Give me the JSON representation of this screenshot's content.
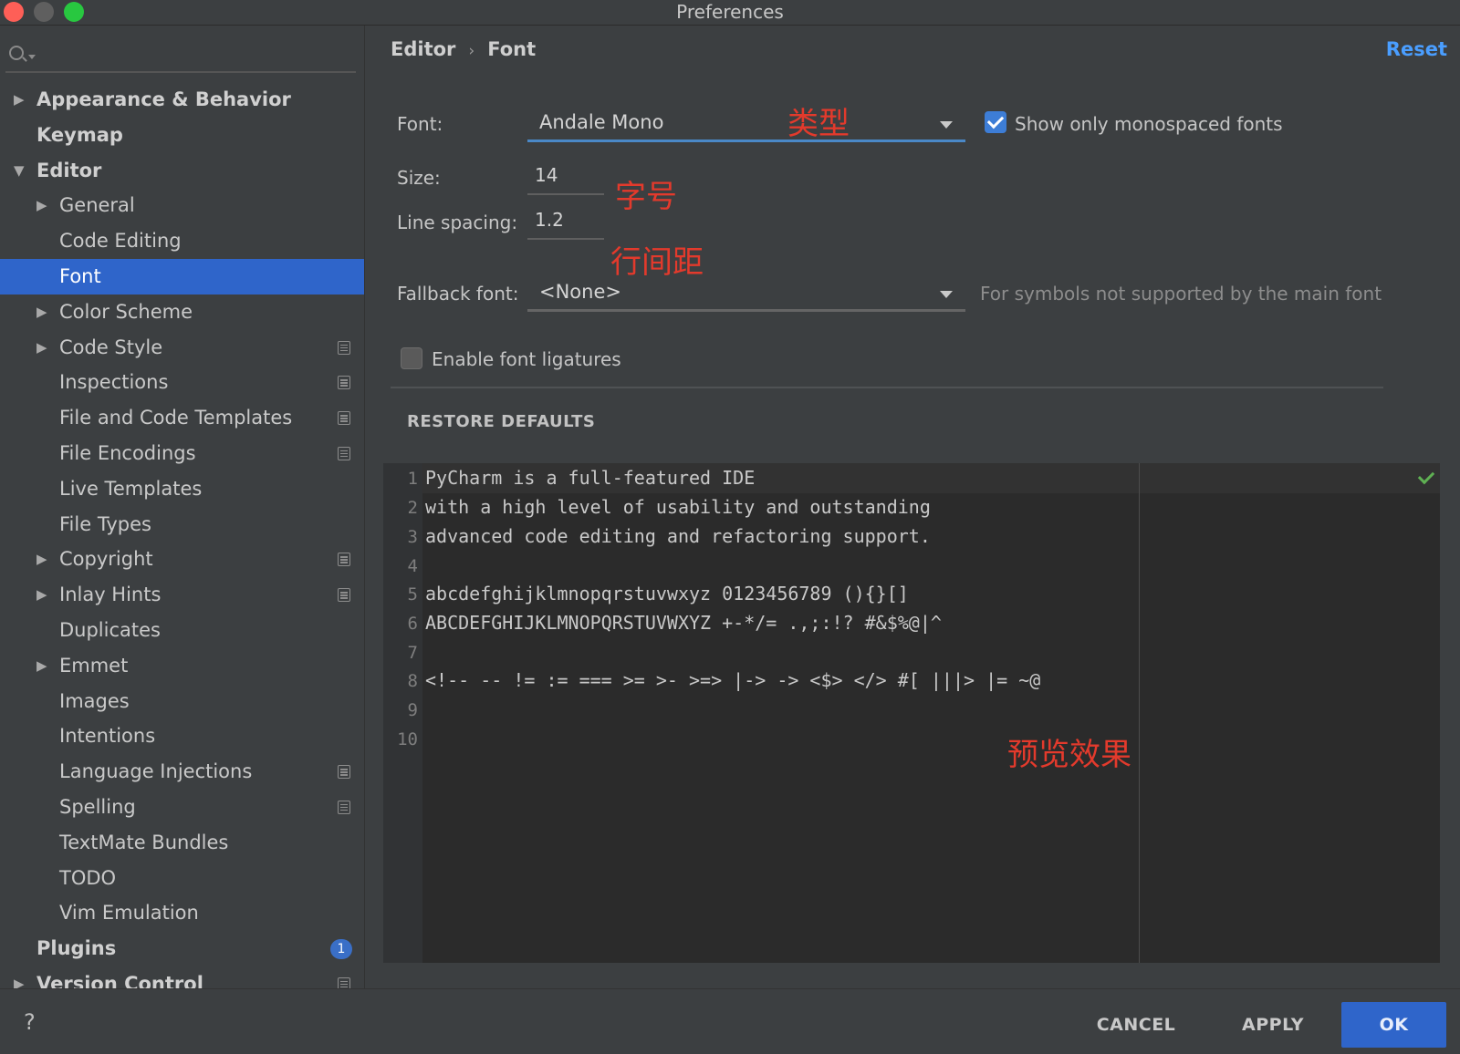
{
  "window": {
    "title": "Preferences"
  },
  "search": {
    "placeholder": "",
    "value": ""
  },
  "sidebar": {
    "items": [
      {
        "label": "Appearance & Behavior",
        "level": 0,
        "arrow": "right",
        "config": false
      },
      {
        "label": "Keymap",
        "level": 0,
        "arrow": "",
        "config": false
      },
      {
        "label": "Editor",
        "level": 0,
        "arrow": "down",
        "config": false
      },
      {
        "label": "General",
        "level": 1,
        "arrow": "right",
        "config": false
      },
      {
        "label": "Code Editing",
        "level": 1,
        "arrow": "",
        "config": false
      },
      {
        "label": "Font",
        "level": 1,
        "arrow": "",
        "config": false,
        "selected": true
      },
      {
        "label": "Color Scheme",
        "level": 1,
        "arrow": "right",
        "config": false
      },
      {
        "label": "Code Style",
        "level": 1,
        "arrow": "right",
        "config": true
      },
      {
        "label": "Inspections",
        "level": 1,
        "arrow": "",
        "config": true
      },
      {
        "label": "File and Code Templates",
        "level": 1,
        "arrow": "",
        "config": true
      },
      {
        "label": "File Encodings",
        "level": 1,
        "arrow": "",
        "config": true
      },
      {
        "label": "Live Templates",
        "level": 1,
        "arrow": "",
        "config": false
      },
      {
        "label": "File Types",
        "level": 1,
        "arrow": "",
        "config": false
      },
      {
        "label": "Copyright",
        "level": 1,
        "arrow": "right",
        "config": true
      },
      {
        "label": "Inlay Hints",
        "level": 1,
        "arrow": "right",
        "config": true
      },
      {
        "label": "Duplicates",
        "level": 1,
        "arrow": "",
        "config": false
      },
      {
        "label": "Emmet",
        "level": 1,
        "arrow": "right",
        "config": false
      },
      {
        "label": "Images",
        "level": 1,
        "arrow": "",
        "config": false
      },
      {
        "label": "Intentions",
        "level": 1,
        "arrow": "",
        "config": false
      },
      {
        "label": "Language Injections",
        "level": 1,
        "arrow": "",
        "config": true
      },
      {
        "label": "Spelling",
        "level": 1,
        "arrow": "",
        "config": true
      },
      {
        "label": "TextMate Bundles",
        "level": 1,
        "arrow": "",
        "config": false
      },
      {
        "label": "TODO",
        "level": 1,
        "arrow": "",
        "config": false
      },
      {
        "label": "Vim Emulation",
        "level": 1,
        "arrow": "",
        "config": false
      },
      {
        "label": "Plugins",
        "level": 0,
        "arrow": "",
        "config": false,
        "badge": "1"
      },
      {
        "label": "Version Control",
        "level": 0,
        "arrow": "right",
        "config": true
      }
    ]
  },
  "breadcrumb": {
    "parent": "Editor",
    "separator": "›",
    "current": "Font"
  },
  "reset_label": "Reset",
  "font_settings": {
    "font_label": "Font:",
    "font_value": "Andale Mono",
    "show_mono_label": "Show only monospaced fonts",
    "show_mono_checked": true,
    "size_label": "Size:",
    "size_value": "14",
    "line_spacing_label": "Line spacing:",
    "line_spacing_value": "1.2",
    "fallback_label": "Fallback font:",
    "fallback_value": "<None>",
    "fallback_hint": "For symbols not supported by the main font",
    "ligatures_label": "Enable font ligatures",
    "ligatures_checked": false,
    "restore_label": "RESTORE DEFAULTS"
  },
  "annotations": {
    "type": "类型",
    "size": "字号",
    "line_spacing": "行间距",
    "preview": "预览效果"
  },
  "preview": {
    "lines": [
      {
        "num": "1",
        "text": "PyCharm is a full-featured IDE"
      },
      {
        "num": "2",
        "text": "with a high level of usability and outstanding"
      },
      {
        "num": "3",
        "text": "advanced code editing and refactoring support."
      },
      {
        "num": "4",
        "text": ""
      },
      {
        "num": "5",
        "text": "abcdefghijklmnopqrstuvwxyz 0123456789 (){}[]"
      },
      {
        "num": "6",
        "text": "ABCDEFGHIJKLMNOPQRSTUVWXYZ +-*/= .,;:!? #&$%@|^"
      },
      {
        "num": "7",
        "text": ""
      },
      {
        "num": "8",
        "text": "<!-- -- != := === >= >- >=> |-> -> <$> </> #[ |||> |= ~@"
      },
      {
        "num": "9",
        "text": ""
      },
      {
        "num": "10",
        "text": ""
      }
    ]
  },
  "footer": {
    "help": "?",
    "cancel": "CANCEL",
    "apply": "APPLY",
    "ok": "OK"
  },
  "colors": {
    "accent": "#2f65ca",
    "link": "#4a9eff",
    "annotation": "#e33a2c",
    "background": "#3c3f41",
    "editor_background": "#2b2b2b"
  }
}
